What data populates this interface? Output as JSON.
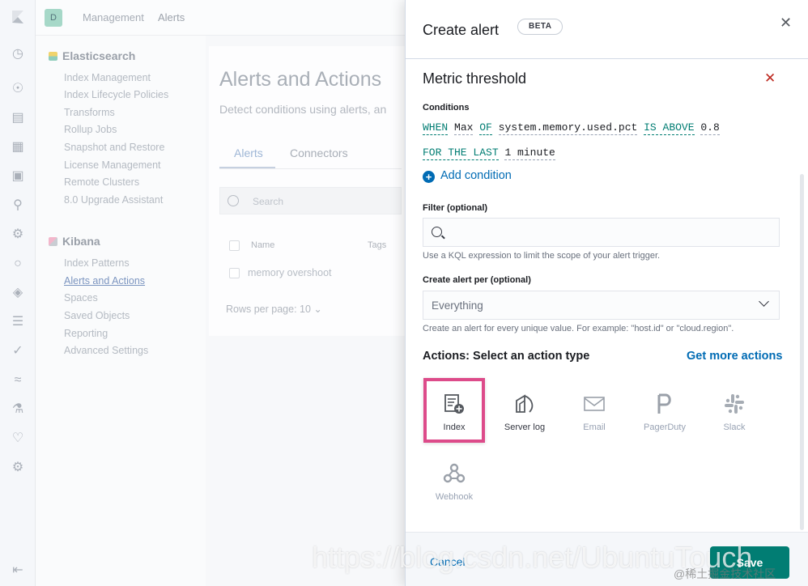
{
  "topbar": {
    "avatar": "D",
    "breadcrumb": [
      "Management",
      "Alerts"
    ]
  },
  "sidebar": {
    "elasticsearch": {
      "title": "Elasticsearch",
      "items": [
        "Index Management",
        "Index Lifecycle Policies",
        "Transforms",
        "Rollup Jobs",
        "Snapshot and Restore",
        "License Management",
        "Remote Clusters",
        "8.0 Upgrade Assistant"
      ]
    },
    "kibana": {
      "title": "Kibana",
      "items": [
        "Index Patterns",
        "Alerts and Actions",
        "Spaces",
        "Saved Objects",
        "Reporting",
        "Advanced Settings"
      ]
    }
  },
  "main": {
    "title": "Alerts and Actions",
    "subtitle": "Detect conditions using alerts, an",
    "tabs": [
      "Alerts",
      "Connectors"
    ],
    "search_placeholder": "Search",
    "columns": [
      "Name",
      "Tags"
    ],
    "row_name": "memory overshoot",
    "rows_per_page": "Rows per page: 10"
  },
  "flyout": {
    "title": "Create alert",
    "badge": "BETA",
    "alert_type": "Metric threshold",
    "conditions_label": "Conditions",
    "condition": {
      "when": "WHEN",
      "agg": "Max",
      "of": "OF",
      "field": "system.memory.used.pct",
      "comparator": "IS ABOVE",
      "threshold": "0.8"
    },
    "window": {
      "for_the_last": "FOR THE LAST",
      "value": "1 minute"
    },
    "add_condition": "Add condition",
    "filter_label": "Filter (optional)",
    "filter_help": "Use a KQL expression to limit the scope of your alert trigger.",
    "group_label": "Create alert per (optional)",
    "group_value": "Everything",
    "group_help": "Create an alert for every unique value. For example: \"host.id\" or \"cloud.region\".",
    "actions_title": "Actions: Select an action type",
    "get_more_actions": "Get more actions",
    "action_types": [
      "Index",
      "Server log",
      "Email",
      "PagerDuty",
      "Slack",
      "Webhook"
    ],
    "cancel": "Cancel",
    "save": "Save"
  },
  "watermark": {
    "url": "https://blog.csdn.net/UbuntuTouch",
    "site": "@稀土掘金技术社区"
  },
  "colors": {
    "accent": "#006bb4",
    "success": "#017d73",
    "danger": "#bd271e",
    "highlight": "#dd4b8a"
  }
}
